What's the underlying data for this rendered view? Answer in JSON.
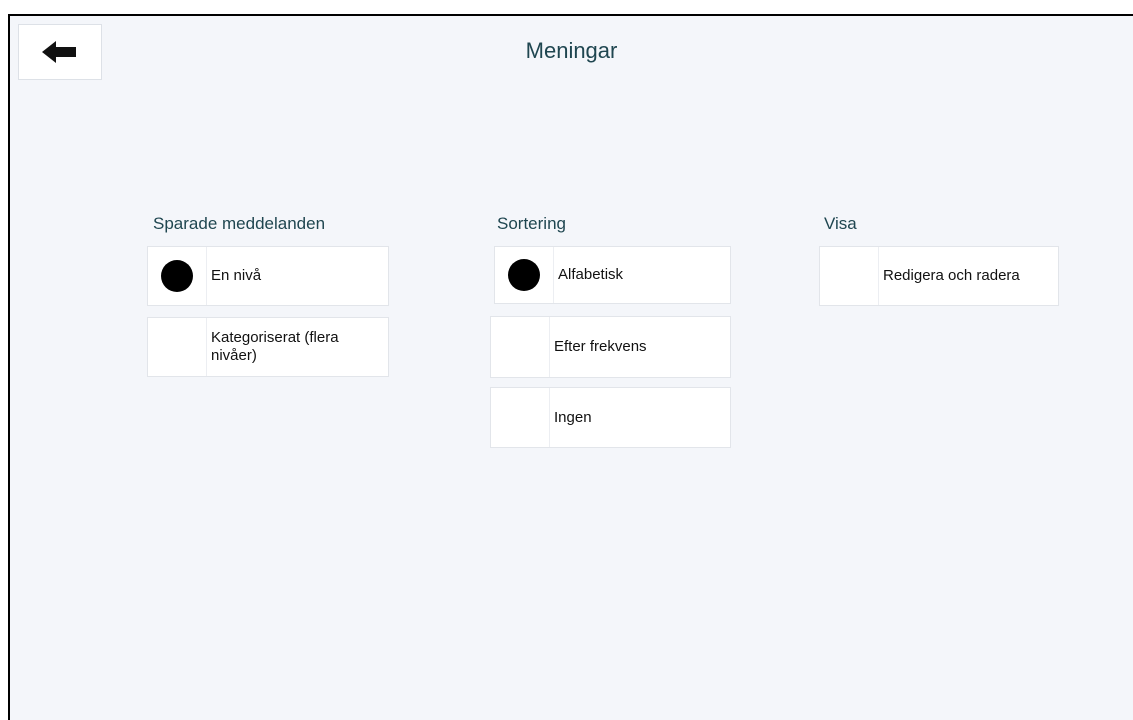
{
  "header": {
    "title": "Meningar",
    "back_icon": "arrow-left-icon"
  },
  "sections": {
    "saved": {
      "title": "Sparade meddelanden",
      "options": [
        {
          "label": "En nivå",
          "selected": true
        },
        {
          "label": "Kategoriserat (flera nivåer)",
          "selected": false
        }
      ]
    },
    "sort": {
      "title": "Sortering",
      "options": [
        {
          "label": "Alfabetisk",
          "selected": true
        },
        {
          "label": "Efter frekvens",
          "selected": false
        },
        {
          "label": "Ingen",
          "selected": false
        }
      ]
    },
    "show": {
      "title": "Visa",
      "options": [
        {
          "label": "Redigera och radera",
          "selected": false
        }
      ]
    }
  }
}
